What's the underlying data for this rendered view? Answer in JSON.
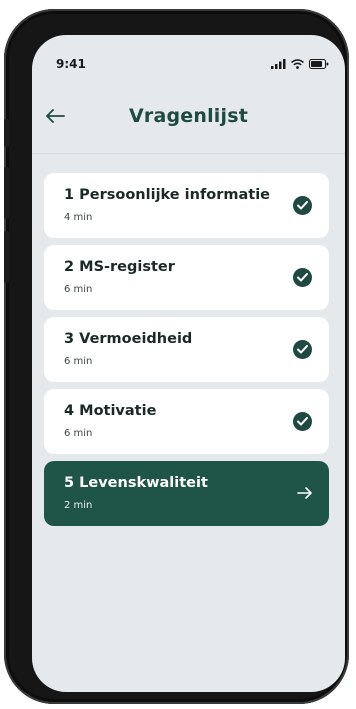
{
  "status": {
    "time": "9:41"
  },
  "header": {
    "title": "Vragenlijst"
  },
  "items": [
    {
      "title": "1 Persoonlijke informatie",
      "duration": "4 min",
      "state": "completed"
    },
    {
      "title": "2 MS-register",
      "duration": "6 min",
      "state": "completed"
    },
    {
      "title": "3 Vermoeidheid",
      "duration": "6 min",
      "state": "completed"
    },
    {
      "title": "4 Motivatie",
      "duration": "6 min",
      "state": "completed"
    },
    {
      "title": "5 Levenskwaliteit",
      "duration": "2 min",
      "state": "active"
    }
  ],
  "colors": {
    "accent": "#1f4a41",
    "active_card": "#1f5547",
    "screen_bg": "#e6e9ec"
  },
  "icons": {
    "back": "arrow-left-icon",
    "done": "check-circle-icon",
    "next": "arrow-right-icon"
  }
}
